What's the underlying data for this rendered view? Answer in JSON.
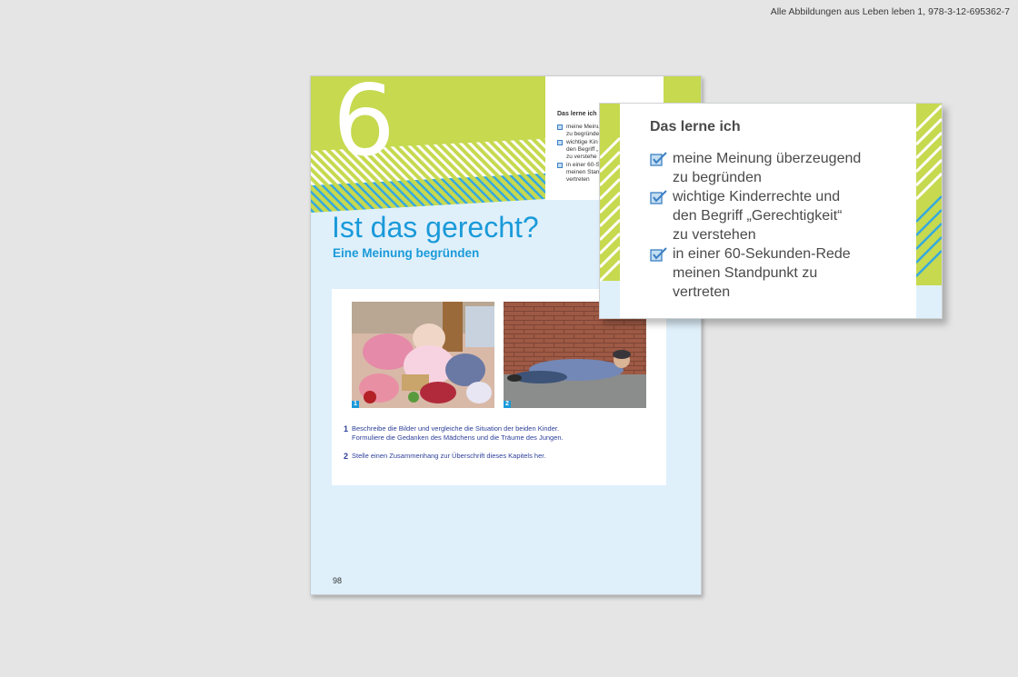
{
  "credit": "Alle Abbildungen aus Leben leben 1, 978-3-12-695362-7",
  "page": {
    "chapter_number": "6",
    "title": "Ist das gerecht?",
    "subtitle": "Eine Meinung begründen",
    "mini_box": {
      "title": "Das lerne ich",
      "items": [
        "meine Meinu\nzu begründe",
        "wichtige Kin\nden Begriff „\nzu verstehe",
        "in einer 60-S\nmeinen Stan\nvertreten"
      ]
    },
    "images": [
      {
        "number": "1",
        "description": "girl in messy toy room"
      },
      {
        "number": "2",
        "description": "boy sleeping by brick wall"
      }
    ],
    "tasks": [
      {
        "number": "1",
        "text": "Beschreibe die Bilder und vergleiche die Situation der beiden Kinder.\nFormuliere die Gedanken des Mädchens und die Träume des Jungen."
      },
      {
        "number": "2",
        "text": "Stelle einen Zusammenhang zur Überschrift dieses Kapitels her."
      }
    ],
    "page_number": "98"
  },
  "zoom": {
    "title": "Das lerne ich",
    "items": [
      "meine Meinung überzeugend\nzu begründen",
      "wichtige Kinderrechte und\nden Begriff „Gerechtigkeit“\nzu verstehen",
      "in einer 60-Sekunden-Rede\nmeinen Standpunkt zu\nvertreten"
    ]
  },
  "colors": {
    "band_green": "#c6d94f",
    "stripe_blue": "#35a8e0",
    "title_blue": "#1a9ad9",
    "task_blue": "#2c3f99",
    "light_blue_bg": "#dff0fb"
  }
}
